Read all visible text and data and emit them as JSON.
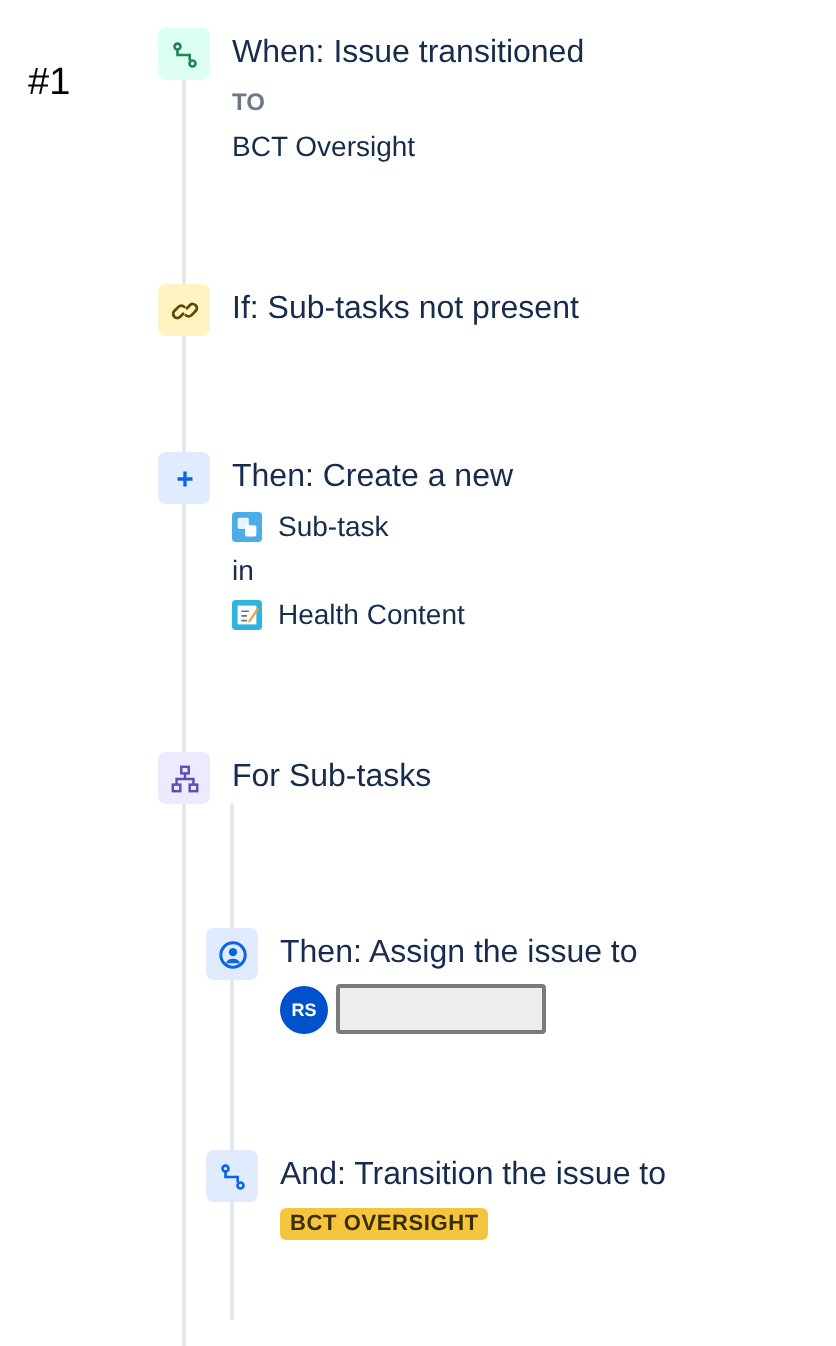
{
  "label": "#1",
  "steps": [
    {
      "kind": "trigger",
      "title": "When: Issue transitioned",
      "details": [
        {
          "kind": "label",
          "text": "TO"
        },
        {
          "kind": "text",
          "text": "BCT Oversight"
        }
      ]
    },
    {
      "kind": "condition",
      "title": "If: Sub-tasks not present"
    },
    {
      "kind": "action",
      "title": "Then: Create a new",
      "details": [
        {
          "kind": "issue-type",
          "text": "Sub-task"
        },
        {
          "kind": "text",
          "text": "in"
        },
        {
          "kind": "project",
          "text": "Health Content"
        }
      ]
    },
    {
      "kind": "branch",
      "title": "For Sub-tasks",
      "children": [
        {
          "kind": "assign",
          "title": "Then: Assign the issue to",
          "details": [
            {
              "kind": "user",
              "text": "RS"
            }
          ]
        },
        {
          "kind": "transition",
          "title": "And: Transition the issue to",
          "details": [
            {
              "kind": "lozenge",
              "text": "BCT OVERSIGHT"
            }
          ]
        }
      ]
    }
  ]
}
